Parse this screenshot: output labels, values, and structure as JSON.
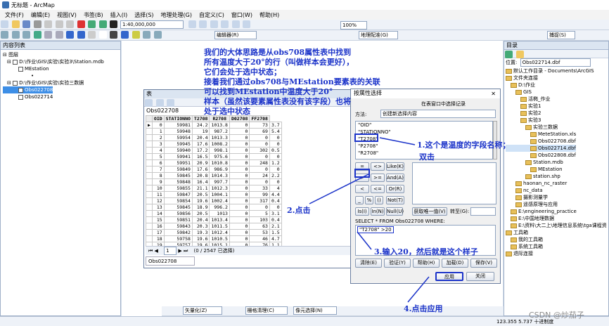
{
  "app": {
    "title": "无标题 - ArcMap"
  },
  "menu": [
    "文件(F)",
    "编辑(E)",
    "视图(V)",
    "书签(B)",
    "插入(I)",
    "选择(S)",
    "地理处理(G)",
    "自定义(C)",
    "窗口(W)",
    "帮助(H)"
  ],
  "toolbar": {
    "scale": "1:40,000,000",
    "zoom": "100%",
    "editor_label": "编辑器(R)",
    "geoprocess_label": "地理配准(G)",
    "snap_label": "捕捉(S)"
  },
  "toc": {
    "title": "内容列表",
    "root": "图层",
    "groups": [
      {
        "path": "D:\\作业\\GIS\\实验\\实验3\\Station.mdb",
        "layers": [
          "MEstation"
        ]
      },
      {
        "path": "D:\\作业\\GIS\\实验\\实验三数据",
        "layers": [
          "Obs022708",
          "Obs022714"
        ]
      }
    ]
  },
  "table_window": {
    "title": "表",
    "tab_name": "Obs022708",
    "columns": [
      "",
      "OID",
      "STATIONNO",
      "T2708",
      "R2708",
      "D02708",
      "FF2708"
    ],
    "rows": [
      [
        "▶",
        "0",
        "59981",
        "24.2",
        "1013.8",
        "0",
        "73",
        "3.7"
      ],
      [
        "",
        "1",
        "59948",
        "19",
        "987.2",
        "0",
        "69",
        "5.4"
      ],
      [
        "",
        "2",
        "59954",
        "20.4",
        "1013.3",
        "0",
        "0",
        "0"
      ],
      [
        "",
        "3",
        "59945",
        "17.6",
        "1008.2",
        "0",
        "0",
        "0"
      ],
      [
        "",
        "4",
        "59940",
        "17.2",
        "998.1",
        "0",
        "302",
        "0.5"
      ],
      [
        "",
        "5",
        "59941",
        "16.5",
        "975.6",
        "0",
        "0",
        "0"
      ],
      [
        "",
        "6",
        "59951",
        "20.9",
        "1010.8",
        "0",
        "248",
        "1.2"
      ],
      [
        "",
        "7",
        "59849",
        "17.6",
        "986.9",
        "0",
        "0",
        "0"
      ],
      [
        "",
        "8",
        "59845",
        "20.8",
        "1014.3",
        "0",
        "24",
        "2.2"
      ],
      [
        "",
        "9",
        "59848",
        "16.4",
        "997.7",
        "0",
        "0",
        "0"
      ],
      [
        "",
        "10",
        "59855",
        "21.1",
        "1012.3",
        "0",
        "33",
        "4"
      ],
      [
        "",
        "11",
        "59847",
        "20.5",
        "1004.1",
        "0",
        "99",
        "4.4"
      ],
      [
        "",
        "12",
        "59854",
        "19.6",
        "1002.4",
        "0",
        "317",
        "0.4"
      ],
      [
        "",
        "13",
        "59845",
        "18.9",
        "996.2",
        "0",
        "0",
        "0"
      ],
      [
        "",
        "14",
        "59856",
        "20.5",
        "1013",
        "0",
        "5",
        "3.1"
      ],
      [
        "",
        "15",
        "59851",
        "20.4",
        "1013.4",
        "0",
        "103",
        "0.4"
      ],
      [
        "",
        "16",
        "59843",
        "20.3",
        "1011.5",
        "0",
        "63",
        "2.1"
      ],
      [
        "",
        "17",
        "59842",
        "19.3",
        "1012.4",
        "0",
        "53",
        "1.5"
      ],
      [
        "",
        "18",
        "59758",
        "19.6",
        "1010.5",
        "0",
        "46",
        "4.7"
      ],
      [
        "",
        "19",
        "59757",
        "19.6",
        "1015.1",
        "0",
        "76",
        "1.1"
      ]
    ],
    "record_nav": "1",
    "record_status": "(0 / 2547 已选择)",
    "bottom_tab": "Obs022708"
  },
  "select_dialog": {
    "title": "按属性选择",
    "hint": "在表窗口中选择记录",
    "method_label": "方法:",
    "method_value": "创建新选择内容",
    "fields": [
      "\"OID\"",
      "\"STATIONNO\"",
      "\"T2708\"",
      "\"P2708\"",
      "\"R2708\""
    ],
    "operators": [
      "=",
      "<>",
      "Like(K)",
      ">",
      ">=",
      "And(A)",
      "<",
      "<=",
      "Or(R)",
      "_",
      "%",
      "()",
      "Not(T)"
    ],
    "is_label": "Is(I)",
    "in_label": "In(N)",
    "null_label": "Null(U)",
    "unique_label": "获取唯一值(V)",
    "goto_label": "转至(G):",
    "sql_label": "SELECT * FROM Obs022708 WHERE:",
    "sql_value": "\"T2708\" >20",
    "buttons": [
      "清除(E)",
      "验证(Y)",
      "帮助(H)",
      "加载(D)",
      "保存(V)"
    ],
    "apply": "应用",
    "close": "关闭"
  },
  "catalog": {
    "title": "目录",
    "location_label": "位置:",
    "location_value": "Obs022714.dbf",
    "items": [
      {
        "t": "默认工作目录 - Documents\\ArcGIS",
        "lv": 0
      },
      {
        "t": "文件夹连接",
        "lv": 0
      },
      {
        "t": "D:\\作业",
        "lv": 1
      },
      {
        "t": "GIS",
        "lv": 2
      },
      {
        "t": "活椭_作业",
        "lv": 3
      },
      {
        "t": "实验1",
        "lv": 3
      },
      {
        "t": "实验2",
        "lv": 3
      },
      {
        "t": "实验3",
        "lv": 3
      },
      {
        "t": "实验三数据",
        "lv": 4
      },
      {
        "t": "MeteStation.xls",
        "lv": 5
      },
      {
        "t": "Obs022708.dbf",
        "lv": 5
      },
      {
        "t": "Obs022714.dbf",
        "lv": 5
      },
      {
        "t": "Obs022808.dbf",
        "lv": 5
      },
      {
        "t": "Station.mdb",
        "lv": 4
      },
      {
        "t": "MEstation",
        "lv": 5
      },
      {
        "t": "station.shp",
        "lv": 4
      },
      {
        "t": "haonan_nc_raster",
        "lv": 2
      },
      {
        "t": "nc_data",
        "lv": 2
      },
      {
        "t": "摄影测量学",
        "lv": 2
      },
      {
        "t": "遥感原理与应用",
        "lv": 2
      },
      {
        "t": "E:\\engineering_practice",
        "lv": 1
      },
      {
        "t": "E:\\中国地理数据",
        "lv": 1
      },
      {
        "t": "E:\\资料\\大二上\\地理信息系统\\tga课程资",
        "lv": 1
      },
      {
        "t": "工具箱",
        "lv": 0
      },
      {
        "t": "我的工具箱",
        "lv": 1
      },
      {
        "t": "系统工具箱",
        "lv": 1
      },
      {
        "t": "退际连接",
        "lv": 0
      }
    ]
  },
  "bottom_toolbar": {
    "vectorize": "矢量化(Z)",
    "raster_clean": "栅格清理(C)",
    "cell_select": "像元选择(N)"
  },
  "status": {
    "coords": "123.355  5.737 十进制度"
  },
  "annotations": {
    "intro": [
      "我们的大体思路是从obs708属性表中找到",
      "所有温度大于20°的行（叫做样本会更好），",
      "它们会处于选中状态；",
      "接着我们通过obs708与MEstation要素表的关联",
      "可以找到MEstation中温度大于20°",
      "样本（虽然该要素属性表没有该字段）也将",
      "处于选中状态"
    ],
    "step1": "1.这个是温度的字段名称；",
    "step1b": "双击",
    "step2": "2.点击",
    "step3": "3.输入20，然后就是这个样子",
    "step4": "4.点击应用",
    "watermark": "CSDN @炒茄子"
  },
  "colors": {
    "annotation": "#1b33c9",
    "highlight_box": "#1b33c9"
  }
}
